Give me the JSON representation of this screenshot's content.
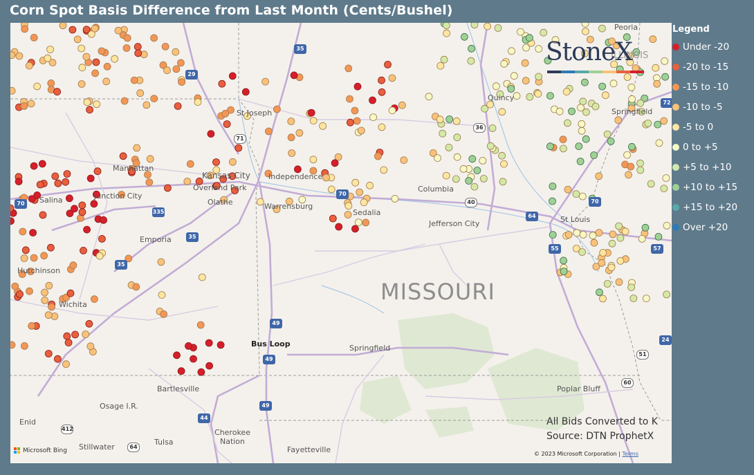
{
  "title": "Corn Spot Basis Difference from Last Month (Cents/Bushel)",
  "legend": {
    "title": "Legend",
    "items": [
      {
        "label": "Under -20",
        "color": "#d61f2b"
      },
      {
        "label": "-20 to -15",
        "color": "#e8603d"
      },
      {
        "label": "-15 to -10",
        "color": "#f39656"
      },
      {
        "label": "-10 to -5",
        "color": "#f9c27a"
      },
      {
        "label": "-5 to 0",
        "color": "#fde6a0"
      },
      {
        "label": "0 to +5",
        "color": "#f6f8c6"
      },
      {
        "label": "+5 to +10",
        "color": "#d3e9a8"
      },
      {
        "label": "+10 to +15",
        "color": "#9fd194"
      },
      {
        "label": "+15 to +20",
        "color": "#5aa9a9"
      },
      {
        "label": "Over +20",
        "color": "#2c7bb6"
      }
    ]
  },
  "map": {
    "state_label": "MISSOURI",
    "places": [
      "St Joseph",
      "Manhattan",
      "Kansas City",
      "Independence",
      "Overland Park",
      "Olathe",
      "Junction City",
      "Salina",
      "Warrensburg",
      "Sedalia",
      "Columbia",
      "Jefferson City",
      "Emporia",
      "Hutchinson",
      "Wichita",
      "Bus Loop",
      "Springfield",
      "Bartlesville",
      "Osage I.R.",
      "Enid",
      "Cherokee Nation",
      "Stillwater",
      "Tulsa",
      "Fayetteville",
      "Poplar Bluff",
      "Quincy",
      "Springfield",
      "St Louis",
      "Peoria",
      "ILLINOIS"
    ],
    "highway_shields": [
      "35",
      "29",
      "71",
      "36",
      "70",
      "335",
      "35",
      "35",
      "70",
      "40",
      "64",
      "55",
      "57",
      "72",
      "70",
      "49",
      "49",
      "44",
      "412",
      "64",
      "49",
      "24",
      "51",
      "60"
    ]
  },
  "logo": {
    "text": "StoneX"
  },
  "notes": {
    "bids": "All Bids Converted to K",
    "source": "Source: DTN ProphetX"
  },
  "attribution": {
    "bing": "Microsoft Bing",
    "copyright": "© 2023 Microsoft Corporation",
    "terms": "Terms"
  }
}
